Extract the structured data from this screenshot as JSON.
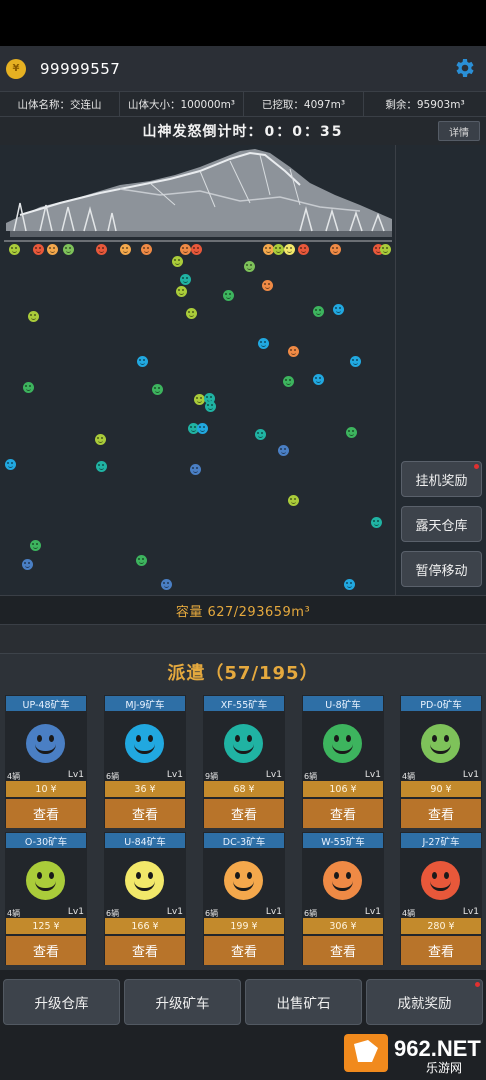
{
  "header": {
    "coin_icon": "coin-icon",
    "coins": "99999557",
    "settings_icon": "gear-icon"
  },
  "info": {
    "mountain_name": "山体名称：交连山",
    "mountain_size": "山体大小：100000m³",
    "mined": "已挖取：4097m³",
    "remaining": "剩余：95903m³"
  },
  "countdown": {
    "label": "山神发怒倒计时：",
    "value": "0：0：35",
    "detail_button": "详情"
  },
  "side_buttons": {
    "idle_reward": "挂机奖励",
    "open_storage": "露天仓库",
    "pause": "暂停移动"
  },
  "capacity": {
    "text": "容量 627/293659m³"
  },
  "dispatch": {
    "title": "派遣（57/195）",
    "cards": [
      {
        "name": "UP-48矿车",
        "count": "4辆",
        "level": "Lv1",
        "price": "10 ¥",
        "view": "查看",
        "color": "#4a7fc4"
      },
      {
        "name": "MJ-9矿车",
        "count": "6辆",
        "level": "Lv1",
        "price": "36 ¥",
        "view": "查看",
        "color": "#21a8e0"
      },
      {
        "name": "XF-55矿车",
        "count": "9辆",
        "level": "Lv1",
        "price": "68 ¥",
        "view": "查看",
        "color": "#20b3a3"
      },
      {
        "name": "U-8矿车",
        "count": "6辆",
        "level": "Lv1",
        "price": "106 ¥",
        "view": "查看",
        "color": "#3db45e"
      },
      {
        "name": "PD-0矿车",
        "count": "4辆",
        "level": "Lv1",
        "price": "90 ¥",
        "view": "查看",
        "color": "#7ec25a"
      },
      {
        "name": "O-30矿车",
        "count": "4辆",
        "level": "Lv1",
        "price": "125 ¥",
        "view": "查看",
        "color": "#aacc3a"
      },
      {
        "name": "U-84矿车",
        "count": "6辆",
        "level": "Lv1",
        "price": "166 ¥",
        "view": "查看",
        "color": "#f2e86a"
      },
      {
        "name": "DC-3矿车",
        "count": "6辆",
        "level": "Lv1",
        "price": "199 ¥",
        "view": "查看",
        "color": "#f4a84c"
      },
      {
        "name": "W-55矿车",
        "count": "6辆",
        "level": "Lv1",
        "price": "306 ¥",
        "view": "查看",
        "color": "#ef8a45"
      },
      {
        "name": "J-27矿车",
        "count": "4辆",
        "level": "Lv1",
        "price": "280 ¥",
        "view": "查看",
        "color": "#e8583a"
      }
    ]
  },
  "bottom_buttons": {
    "upgrade_storage": "升级仓库",
    "upgrade_cart": "升级矿车",
    "sell_ore": "出售矿石",
    "achievement": "成就奖励"
  },
  "watermark": {
    "brand": "962.NET",
    "sub": "乐游网"
  }
}
